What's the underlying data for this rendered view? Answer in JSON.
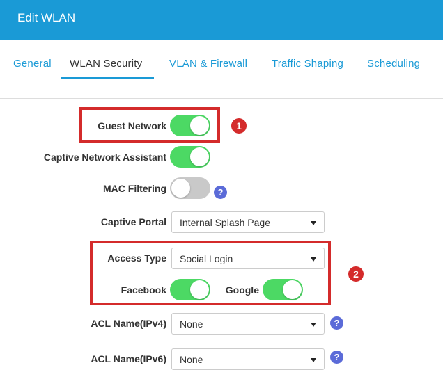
{
  "header": {
    "title": "Edit WLAN"
  },
  "tabs": [
    {
      "label": "General"
    },
    {
      "label": "WLAN Security"
    },
    {
      "label": "VLAN & Firewall"
    },
    {
      "label": "Traffic Shaping"
    },
    {
      "label": "Scheduling"
    }
  ],
  "active_tab": "WLAN Security",
  "form": {
    "guest_network": {
      "label": "Guest Network",
      "enabled": true
    },
    "captive_network_assistant": {
      "label": "Captive Network Assistant",
      "enabled": true
    },
    "mac_filtering": {
      "label": "MAC Filtering",
      "enabled": false,
      "help": "?"
    },
    "captive_portal": {
      "label": "Captive Portal",
      "value": "Internal Splash Page"
    },
    "access_type": {
      "label": "Access Type",
      "value": "Social Login"
    },
    "facebook": {
      "label": "Facebook",
      "enabled": true
    },
    "google": {
      "label": "Google",
      "enabled": true
    },
    "acl_ipv4": {
      "label": "ACL Name(IPv4)",
      "value": "None",
      "help": "?"
    },
    "acl_ipv6": {
      "label": "ACL Name(IPv6)",
      "value": "None",
      "help": "?"
    }
  },
  "annotations": {
    "callout_1": "1",
    "callout_2": "2"
  },
  "colors": {
    "header": "#1a9ad6",
    "toggle_on": "#4cd964",
    "toggle_off": "#c9c9c9",
    "help_icon": "#5b6bd8",
    "callout": "#d42b2b"
  }
}
